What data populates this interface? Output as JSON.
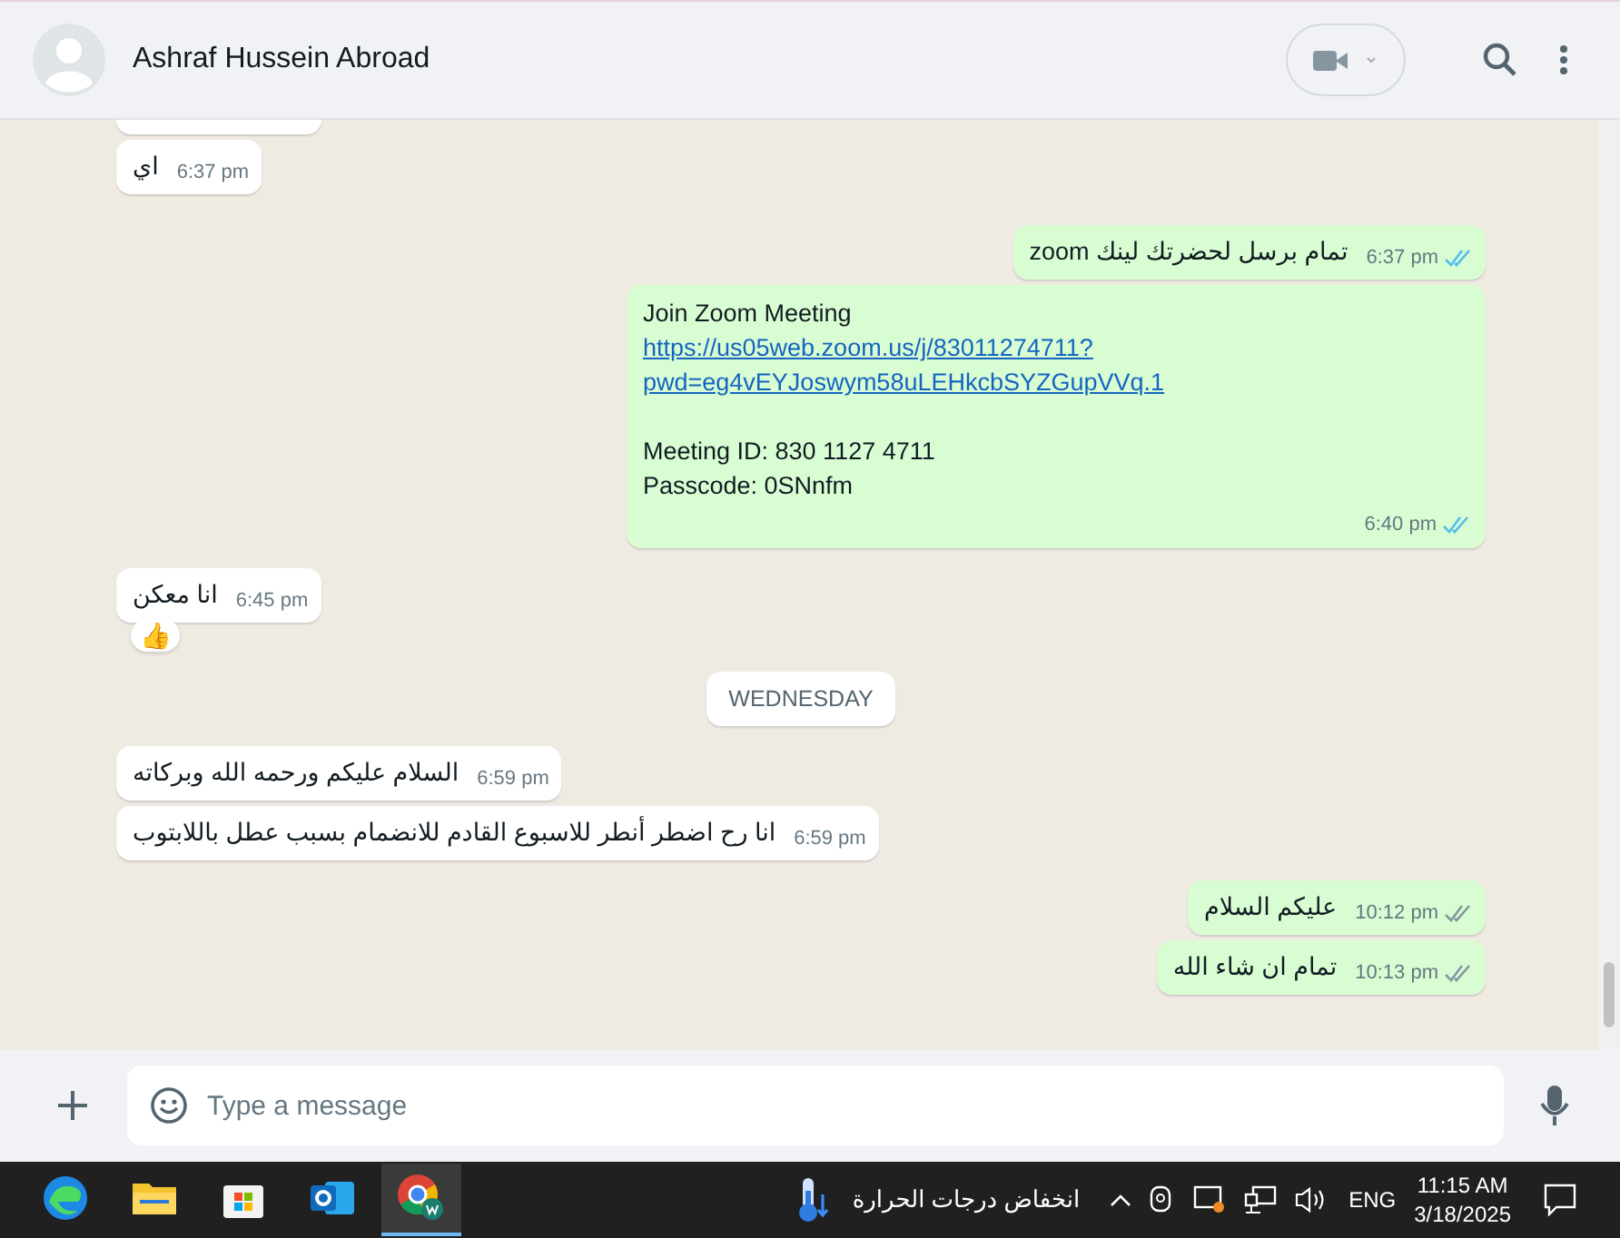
{
  "header": {
    "contact_name": "Ashraf Hussein Abroad"
  },
  "messages": [
    {
      "kind": "cut"
    },
    {
      "kind": "incoming",
      "text": "اي",
      "time": "6:37 pm"
    },
    {
      "kind": "outgoing",
      "text": "تمام برسل لحضرتك لينك zoom",
      "time": "6:37 pm",
      "read": true
    },
    {
      "kind": "outgoing_rich",
      "paragraphs": [
        [
          {
            "text": "Join Zoom Meeting",
            "link": false
          },
          {
            "text": "https://us05web.zoom.us/j/83011274711?",
            "link": true
          },
          {
            "text": "pwd=eg4vEYJoswym58uLEHkcbSYZGupVVq.1",
            "link": true
          }
        ],
        [
          {
            "text": "Meeting ID: 830 1127 4711",
            "link": false
          },
          {
            "text": "Passcode: 0SNnfm",
            "link": false
          }
        ]
      ],
      "time": "6:40 pm",
      "read": true
    },
    {
      "kind": "incoming",
      "text": "انا معكن",
      "time": "6:45 pm",
      "reaction": "👍"
    },
    {
      "kind": "date",
      "text": "WEDNESDAY"
    },
    {
      "kind": "incoming",
      "text": "السلام عليكم ورحمه الله وبركاته",
      "time": "6:59 pm"
    },
    {
      "kind": "incoming",
      "text": "انا رح اضطر أنطر للاسبوع القادم للانضمام بسبب عطل باللابتوب",
      "time": "6:59 pm"
    },
    {
      "kind": "outgoing",
      "text": "عليكم السلام",
      "time": "10:12 pm",
      "read": false
    },
    {
      "kind": "outgoing",
      "text": "تمام ان شاء الله",
      "time": "10:13 pm",
      "read": false
    }
  ],
  "composer": {
    "placeholder": "Type a message"
  },
  "taskbar": {
    "apps": [
      {
        "kind": "edge",
        "selected": false
      },
      {
        "kind": "folder",
        "selected": false
      },
      {
        "kind": "store",
        "selected": false
      },
      {
        "kind": "outlook",
        "selected": false
      },
      {
        "kind": "chrome",
        "selected": true
      }
    ],
    "weather": "انخفاض درجات الحرارة",
    "language": "ENG",
    "time": "11:15 AM",
    "date": "3/18/2025"
  }
}
